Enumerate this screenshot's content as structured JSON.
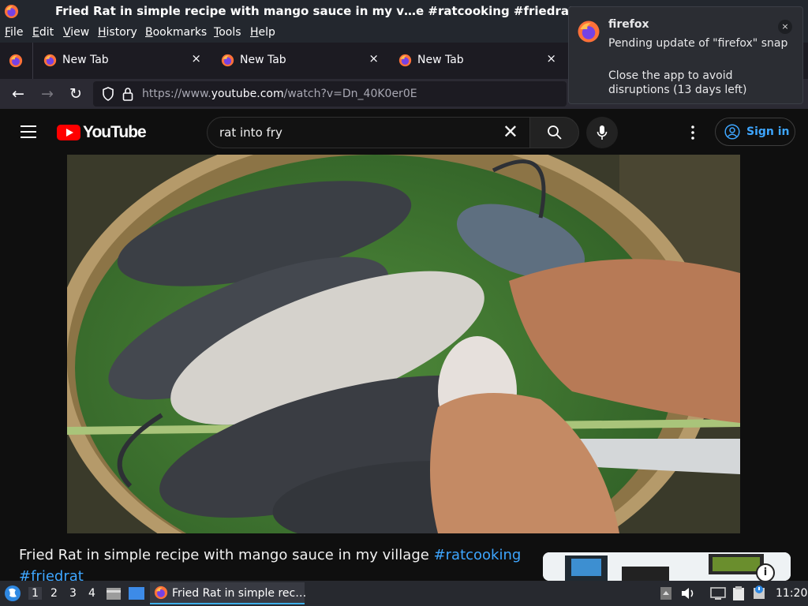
{
  "window": {
    "title": "Fried Rat in simple recipe with mango sauce in my v…e #ratcooking #friedrat"
  },
  "menu": [
    "File",
    "Edit",
    "View",
    "History",
    "Bookmarks",
    "Tools",
    "Help"
  ],
  "menu_mnemonics": [
    "F",
    "E",
    "V",
    "H",
    "B",
    "T",
    "H"
  ],
  "tabs": [
    {
      "label": "New Tab",
      "close": "×"
    },
    {
      "label": "New Tab",
      "close": "×"
    },
    {
      "label": "New Tab",
      "close": "×"
    }
  ],
  "nav": {
    "back": "←",
    "forward": "→",
    "reload": "↻",
    "url_prefix": "https://www.",
    "url_domain": "youtube.com",
    "url_suffix": "/watch?v=Dn_40K0er0E"
  },
  "notification": {
    "title": "firefox",
    "body1": "Pending update of \"firefox\" snap",
    "body2": "Close the app to avoid disruptions (13 days left)",
    "close": "×"
  },
  "youtube": {
    "logo": "YouTube",
    "search_value": "rat into fry",
    "clear": "✕",
    "signin": "Sign in"
  },
  "video": {
    "title_text": "Fried Rat in simple recipe with mango sauce in my village ",
    "tag1": "#ratcooking",
    "tag2": "#friedrat",
    "ad_info": "i"
  },
  "taskbar": {
    "workspaces": [
      "1",
      "2",
      "3",
      "4"
    ],
    "active_window": "Fried Rat in simple rec…",
    "clock": "11:20"
  },
  "colors": {
    "accent": "#3ea6ff",
    "youtube_red": "#ff0000",
    "firefox_orange": "#ff9500"
  }
}
